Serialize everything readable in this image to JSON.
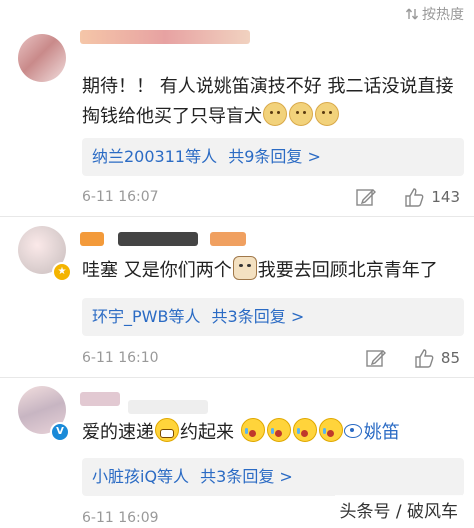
{
  "sort": {
    "label": "按热度"
  },
  "comments": [
    {
      "text_main": "期待！！ 有人说姚笛演技不好  我二话没说直接掏钱给他买了只导盲犬",
      "replies": {
        "who": "纳兰200311等人",
        "count": "共9条回复 >"
      },
      "time": "6-11 16:07",
      "likes": "143"
    },
    {
      "text_before": "哇塞 又是你们两个",
      "text_after": "我要去回顾北京青年了",
      "replies": {
        "who": "环宇_PWB等人",
        "count": "共3条回复 >"
      },
      "time": "6-11 16:10",
      "likes": "85"
    },
    {
      "text_before": "爱的速递",
      "text_after": "约起来",
      "mention": "姚笛",
      "replies": {
        "who": "小脏孩iQ等人",
        "count": "共3条回复 >"
      },
      "time": "6-11 16:09"
    }
  ],
  "watermark": {
    "text": "头条号 / 破风车"
  },
  "colors": {
    "link": "#2b6bc4",
    "meta": "#999999",
    "reply_bg": "#f2f2f2",
    "verified": "#1a8ad8"
  }
}
